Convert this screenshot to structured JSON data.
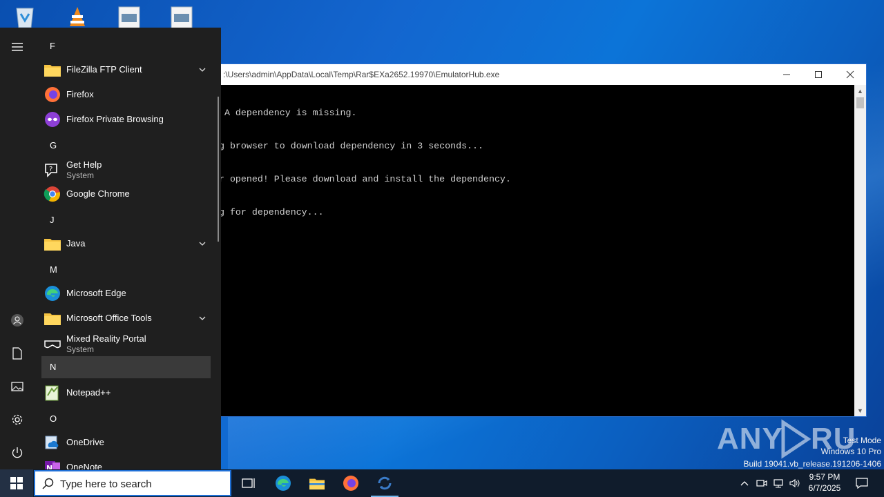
{
  "console": {
    "title": ":\\Users\\admin\\AppData\\Local\\Temp\\Rar$EXa2652.19970\\EmulatorHub.exe",
    "lines": [
      ": A dependency is missing.",
      "ng browser to download dependency in 3 seconds...",
      "er opened! Please download and install the dependency.",
      "ng for dependency..."
    ]
  },
  "start_menu": {
    "sections": [
      {
        "letter": "F"
      },
      {
        "letter": "G"
      },
      {
        "letter": "J"
      },
      {
        "letter": "M"
      },
      {
        "letter": "N"
      },
      {
        "letter": "O"
      }
    ],
    "apps": {
      "filezilla": {
        "name": "FileZilla FTP Client"
      },
      "firefox": {
        "name": "Firefox"
      },
      "firefox_private": {
        "name": "Firefox Private Browsing"
      },
      "get_help": {
        "name": "Get Help",
        "sub": "System"
      },
      "chrome": {
        "name": "Google Chrome"
      },
      "java": {
        "name": "Java"
      },
      "edge": {
        "name": "Microsoft Edge"
      },
      "office_tools": {
        "name": "Microsoft Office Tools"
      },
      "mixed_reality": {
        "name": "Mixed Reality Portal",
        "sub": "System"
      },
      "notepadpp": {
        "name": "Notepad++"
      },
      "onedrive": {
        "name": "OneDrive"
      },
      "onenote": {
        "name": "OneNote"
      }
    }
  },
  "taskbar": {
    "search_placeholder": "Type here to search",
    "time": "9:57 PM",
    "date": "6/7/2025"
  },
  "watermark": {
    "brand": "ANY RUN",
    "mode": "Test Mode",
    "edition": "Windows 10 Pro",
    "build": "Build 19041.vb_release.191206-1406"
  }
}
